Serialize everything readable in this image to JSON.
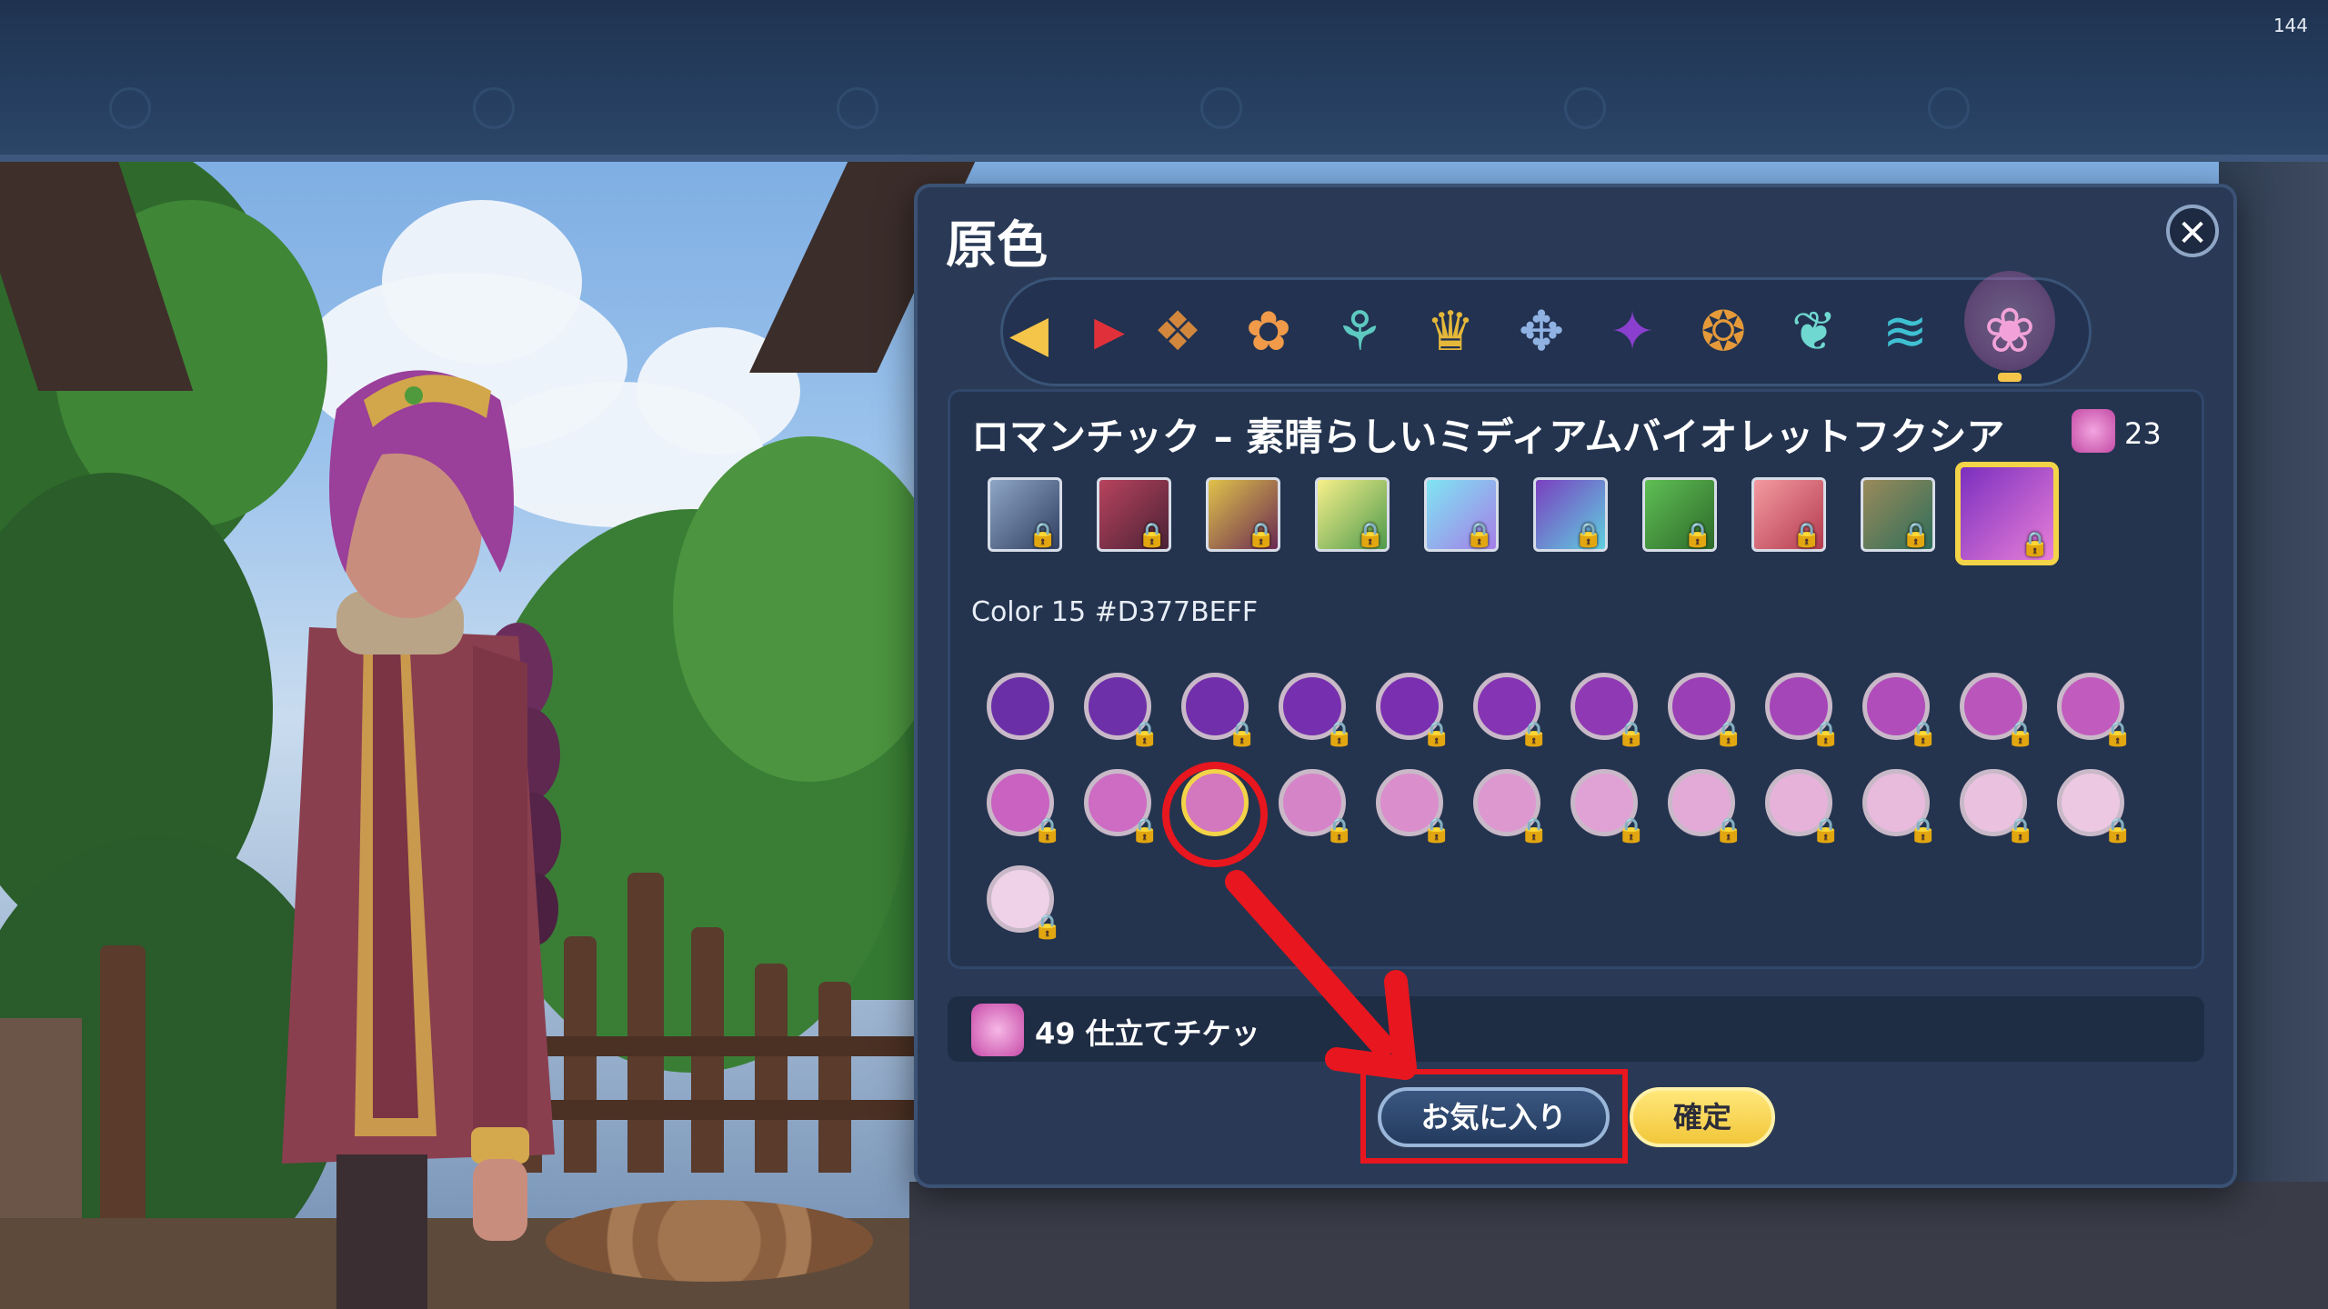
{
  "hud": {
    "fps": "144"
  },
  "dialog": {
    "title": "原色",
    "close_icon": "close-icon",
    "categories": [
      {
        "icon": "arrow-left-icon"
      },
      {
        "icon": "play-triangle-icon"
      },
      {
        "icon": "cat-face-icon"
      },
      {
        "icon": "flame-flower-icon"
      },
      {
        "icon": "sprout-icon"
      },
      {
        "icon": "crown-leaf-icon"
      },
      {
        "icon": "crystal-bloom-icon"
      },
      {
        "icon": "violet-spirit-icon"
      },
      {
        "icon": "spiral-knot-icon"
      },
      {
        "icon": "butterfly-icon"
      },
      {
        "icon": "wave-banner-icon"
      },
      {
        "icon": "lotus-pink-icon",
        "active": true
      }
    ],
    "colorset_name": "ロマンチック – 素晴らしいミディアムバイオレットフクシア",
    "ticket_count": "23",
    "palettes": [
      {
        "colors": [
          "#8fa6c6",
          "#2f3f61"
        ],
        "locked": true
      },
      {
        "colors": [
          "#b8435d",
          "#4a2236"
        ],
        "locked": true
      },
      {
        "colors": [
          "#e0c24a",
          "#6a2a52"
        ],
        "locked": true
      },
      {
        "colors": [
          "#f6f08a",
          "#4f9a4c"
        ],
        "locked": true
      },
      {
        "colors": [
          "#7fe5f2",
          "#a57ee8"
        ],
        "locked": true
      },
      {
        "colors": [
          "#7a3fbf",
          "#5fd0e0"
        ],
        "locked": true
      },
      {
        "colors": [
          "#5fbf54",
          "#2d6a2a"
        ],
        "locked": true
      },
      {
        "colors": [
          "#f49aa0",
          "#b33b4f"
        ],
        "locked": true
      },
      {
        "colors": [
          "#9a8a5a",
          "#2e6e5a"
        ],
        "locked": true
      },
      {
        "colors": [
          "#7b2fbf",
          "#e87fd8"
        ],
        "locked": true,
        "selected": true
      }
    ],
    "color_info": "Color 15 #D377BEFF",
    "swatches": [
      {
        "color": "#6a2fa6",
        "locked": false
      },
      {
        "color": "#6e30a8",
        "locked": true
      },
      {
        "color": "#722fac",
        "locked": true
      },
      {
        "color": "#762fae",
        "locked": true
      },
      {
        "color": "#7a2fb1",
        "locked": true
      },
      {
        "color": "#8535b3",
        "locked": true
      },
      {
        "color": "#8f3ab4",
        "locked": true
      },
      {
        "color": "#9a3fb5",
        "locked": true
      },
      {
        "color": "#a546b8",
        "locked": true
      },
      {
        "color": "#b04dba",
        "locked": true
      },
      {
        "color": "#ba55bc",
        "locked": true
      },
      {
        "color": "#c15cbe",
        "locked": true
      },
      {
        "color": "#c962c0",
        "locked": true
      },
      {
        "color": "#cd6cc2",
        "locked": true
      },
      {
        "color": "#d377be",
        "locked": false,
        "selected": true
      },
      {
        "color": "#d684c8",
        "locked": true
      },
      {
        "color": "#da8ecc",
        "locked": true
      },
      {
        "color": "#dd98d0",
        "locked": true
      },
      {
        "color": "#e0a2d4",
        "locked": true
      },
      {
        "color": "#e3aad8",
        "locked": true
      },
      {
        "color": "#e6b2da",
        "locked": true
      },
      {
        "color": "#e8badc",
        "locked": true
      },
      {
        "color": "#eac1df",
        "locked": true
      },
      {
        "color": "#ecc8e2",
        "locked": true
      },
      {
        "color": "#efd1e8",
        "locked": true
      }
    ],
    "ticket_text": "49 仕立てチケッ",
    "favorite_label": "お気に入り",
    "confirm_label": "確定"
  },
  "colors": {
    "accent_gold": "#f3d348",
    "highlight_red": "#e8161e",
    "panel_bg": "#2a3a56"
  }
}
